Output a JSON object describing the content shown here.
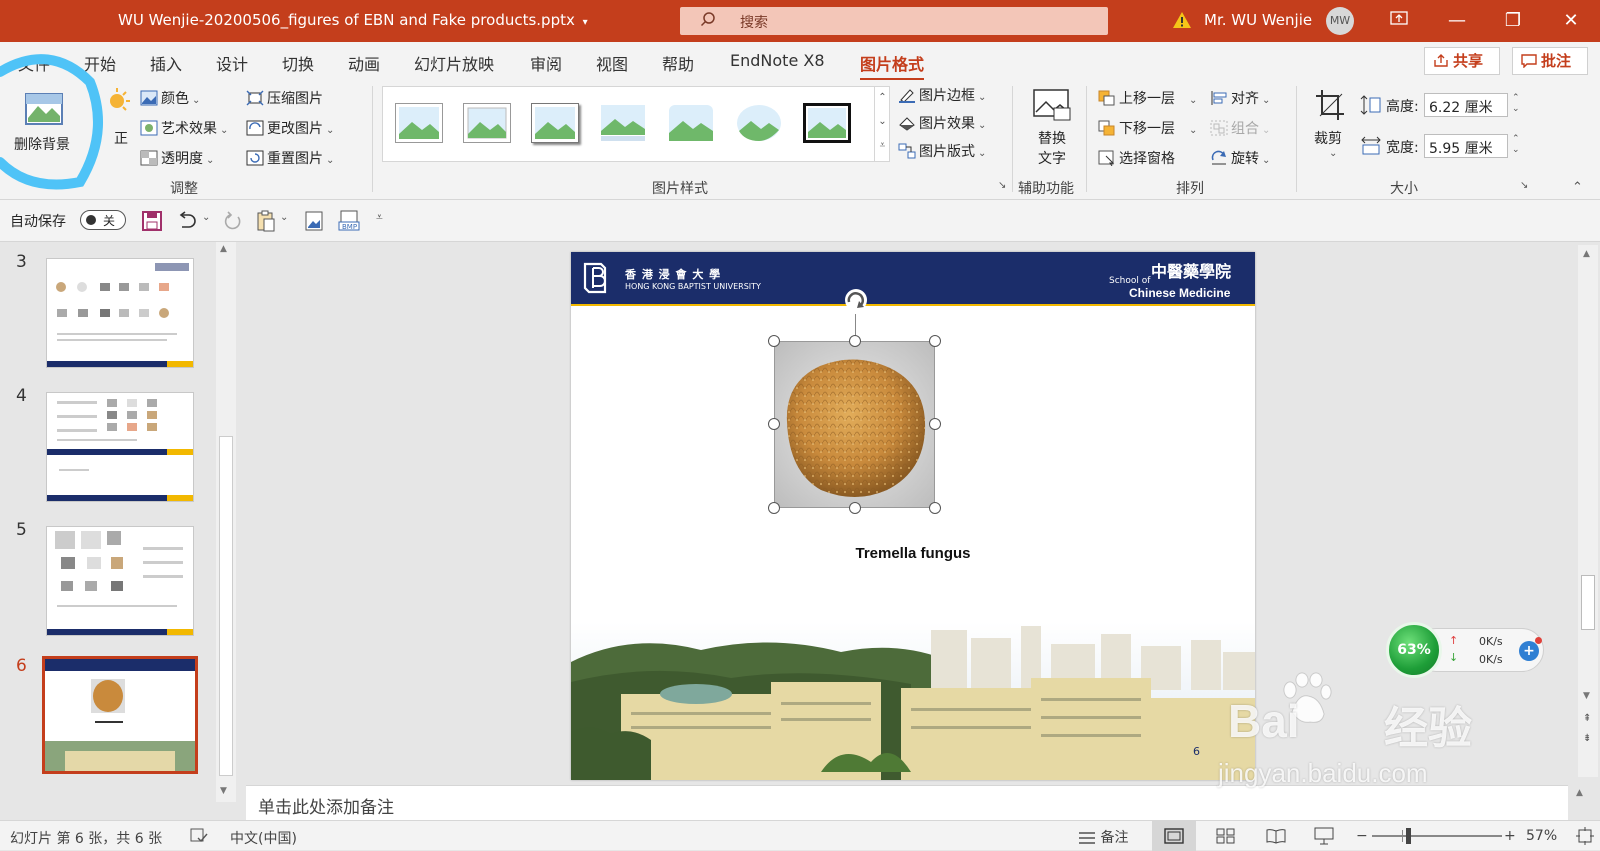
{
  "titlebar": {
    "doc_title": "WU Wenjie-20200506_figures of EBN and Fake products.pptx",
    "search_placeholder": "搜索",
    "user_name": "Mr. WU Wenjie",
    "avatar_initials": "MW"
  },
  "tabs": {
    "items": [
      "文件",
      "开始",
      "插入",
      "设计",
      "切换",
      "动画",
      "幻灯片放映",
      "审阅",
      "视图",
      "帮助",
      "EndNote X8",
      "图片格式"
    ],
    "active": "图片格式",
    "share_label": "共享",
    "comments_label": "批注"
  },
  "ribbon": {
    "adjust": {
      "remove_bg": "删除背景",
      "correct": "正",
      "color": "颜色",
      "artistic": "艺术效果",
      "transparency": "透明度",
      "compress": "压缩图片",
      "change": "更改图片",
      "reset": "重置图片",
      "group_label": "调整"
    },
    "styles": {
      "border": "图片边框",
      "effects": "图片效果",
      "layout": "图片版式",
      "group_label": "图片样式"
    },
    "accessibility": {
      "alt_text_line1": "替换",
      "alt_text_line2": "文字",
      "group_label": "辅助功能"
    },
    "arrange": {
      "bring_forward": "上移一层",
      "send_backward": "下移一层",
      "selection_pane": "选择窗格",
      "align": "对齐",
      "group": "组合",
      "rotate": "旋转",
      "group_label": "排列"
    },
    "size": {
      "crop": "裁剪",
      "height_label": "高度:",
      "height_value": "6.22 厘米",
      "width_label": "宽度:",
      "width_value": "5.95 厘米",
      "group_label": "大小"
    }
  },
  "qat": {
    "autosave_label": "自动保存",
    "toggle_state": "关"
  },
  "thumbnails": [
    {
      "number": "3"
    },
    {
      "number": "4"
    },
    {
      "number": "5"
    },
    {
      "number": "6",
      "active": true
    }
  ],
  "slide": {
    "header_cn": "香 港 浸 會 大 學",
    "header_en": "HONG KONG BAPTIST UNIVERSITY",
    "school_small": "School of",
    "school_cn": "中醫藥學院",
    "school_en": "Chinese Medicine",
    "caption": "Tremella fungus",
    "page_number": "6"
  },
  "notes": {
    "placeholder": "单击此处添加备注"
  },
  "status": {
    "slide_info": "幻灯片 第 6 张，共 6 张",
    "language": "中文(中国)",
    "notes_label": "备注",
    "zoom": "57%"
  },
  "netwidget": {
    "percent": "63%",
    "up_speed": "0K/s",
    "down_speed": "0K/s"
  },
  "watermark": {
    "brand": "Bai",
    "brand_cn": "经验",
    "url": "jingyan.baidu.com"
  },
  "colors": {
    "accent": "#c43e1c",
    "slide_navy": "#1b2d6a",
    "slide_yellow": "#f2b800",
    "highlight_circle": "#4fc3f7"
  }
}
